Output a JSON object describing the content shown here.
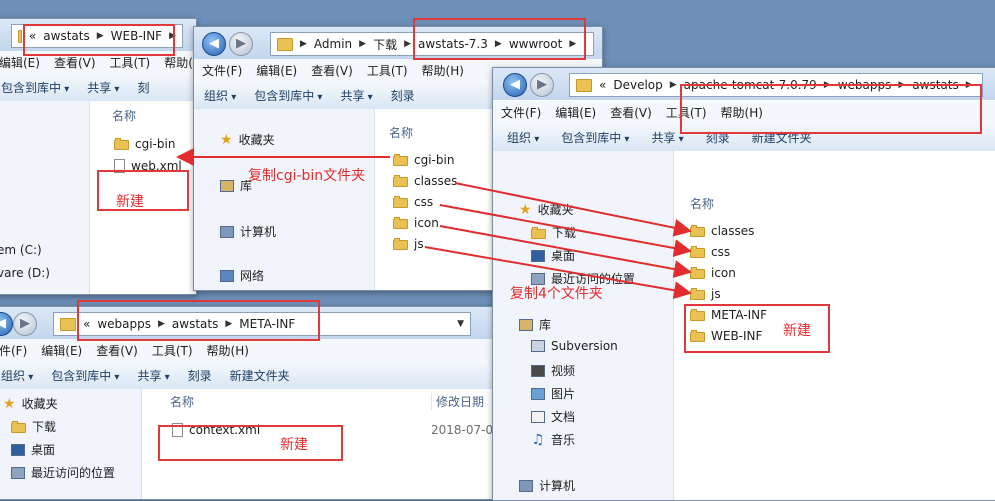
{
  "windows": {
    "win1": {
      "address": [
        "«",
        "awstats",
        "WEB-INF"
      ],
      "menu": [
        "编辑(E)",
        "查看(V)",
        "工具(T)",
        "帮助(H)"
      ],
      "toolbar": [
        "包含到库中",
        "共享",
        "刻"
      ],
      "column_name": "名称",
      "files": [
        {
          "name": "cgi-bin",
          "type": "folder"
        },
        {
          "name": "web.xml",
          "type": "file"
        }
      ],
      "nav": [
        "em (C:)",
        "vare (D:)"
      ]
    },
    "win2": {
      "address": [
        "Admin",
        "下载",
        "awstats-7.3",
        "wwwroot"
      ],
      "menu": [
        "文件(F)",
        "编辑(E)",
        "查看(V)",
        "工具(T)",
        "帮助(H)"
      ],
      "toolbar": [
        "组织",
        "包含到库中",
        "共享",
        "刻录"
      ],
      "column_name": "名称",
      "nav": [
        "收藏夹",
        "库",
        "计算机",
        "网络"
      ],
      "files": [
        "cgi-bin",
        "classes",
        "css",
        "icon",
        "js"
      ]
    },
    "win3": {
      "address": [
        "«",
        "Develop",
        "apache-tomcat-7.0.79",
        "webapps",
        "awstats"
      ],
      "menu": [
        "文件(F)",
        "编辑(E)",
        "查看(V)",
        "工具(T)",
        "帮助(H)"
      ],
      "toolbar": [
        "组织",
        "包含到库中",
        "共享",
        "刻录",
        "新建文件夹"
      ],
      "column_name": "名称",
      "nav": [
        "收藏夹",
        "下载",
        "桌面",
        "最近访问的位置",
        "库",
        "Subversion",
        "视频",
        "图片",
        "文档",
        "音乐",
        "计算机"
      ],
      "files": [
        "classes",
        "css",
        "icon",
        "js",
        "META-INF",
        "WEB-INF"
      ]
    },
    "win4": {
      "address": [
        "«",
        "webapps",
        "awstats",
        "META-INF"
      ],
      "menu": [
        "件(F)",
        "编辑(E)",
        "查看(V)",
        "工具(T)",
        "帮助(H)"
      ],
      "toolbar": [
        "组织",
        "包含到库中",
        "共享",
        "刻录",
        "新建文件夹"
      ],
      "column_name": "名称",
      "column_date": "修改日期",
      "nav": [
        "收藏夹",
        "下载",
        "桌面",
        "最近访问的位置"
      ],
      "files": [
        {
          "name": "context.xml",
          "date": "2018-07-0"
        }
      ]
    }
  },
  "annotations": {
    "copy_cgi": "复制cgi-bin文件夹",
    "copy_four": "复制4个文件夹",
    "new_1": "新建",
    "new_2": "新建",
    "new_3": "新建"
  },
  "colors": {
    "annotation": "#e12d2d",
    "box": "#e0393b",
    "folder": "#e9c253"
  }
}
